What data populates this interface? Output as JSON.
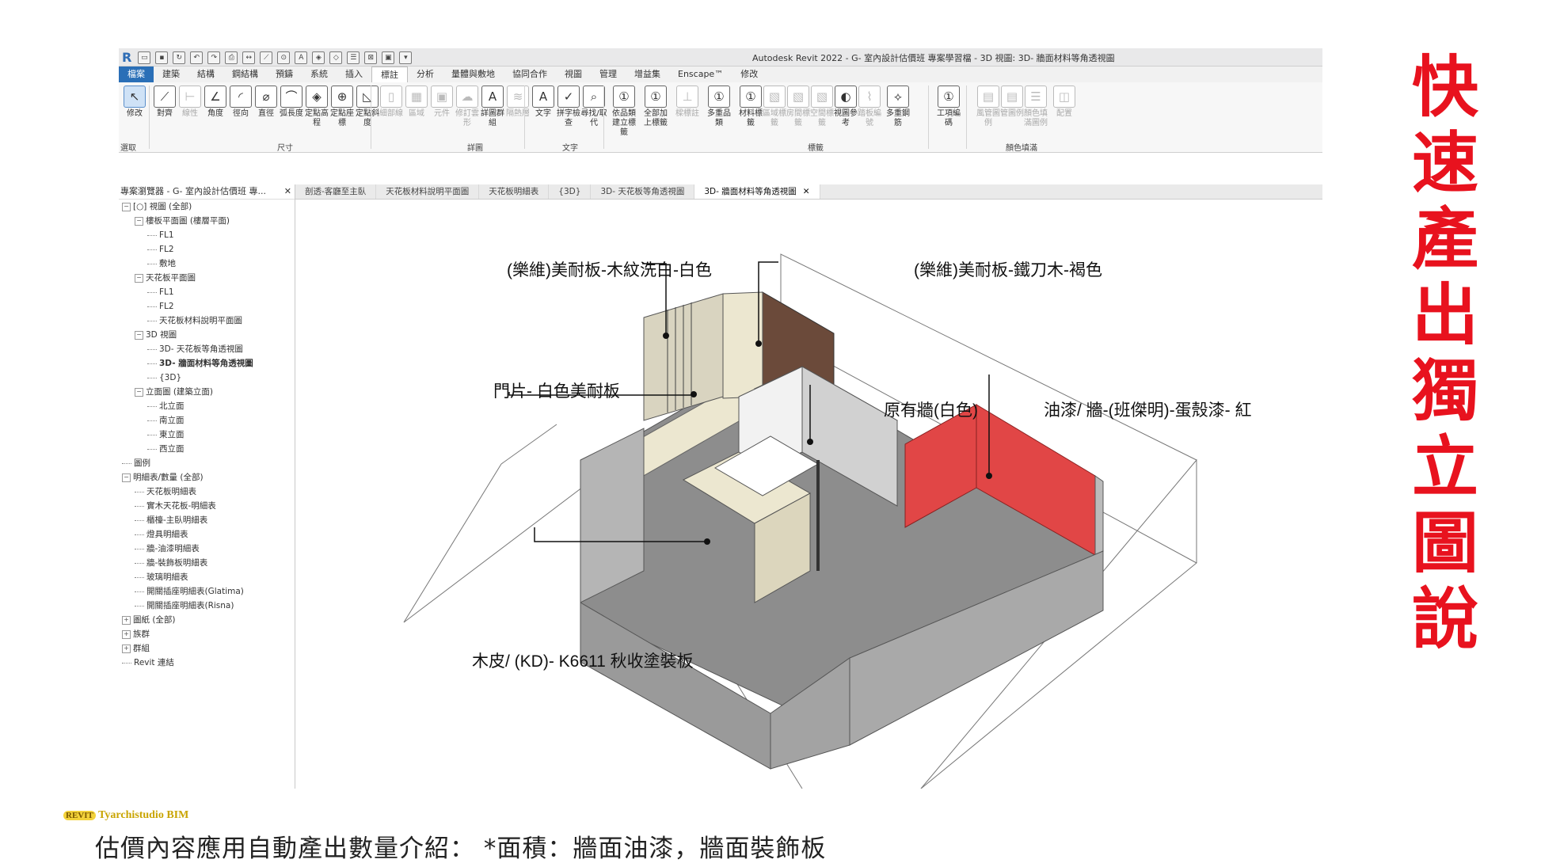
{
  "app": {
    "window_title": "Autodesk Revit 2022 - G- 室內設計估價班 專案學習檔 - 3D 視圖: 3D- 牆面材料等角透視圖",
    "logo_letter": "R",
    "ribbon_tabs": [
      "檔案",
      "建築",
      "結構",
      "鋼結構",
      "預鑄",
      "系統",
      "插入",
      "標註",
      "分析",
      "量體與敷地",
      "協同合作",
      "視圖",
      "管理",
      "增益集",
      "Enscape™",
      "修改"
    ],
    "active_tab_index": 7,
    "ribbon_buttons": [
      {
        "label": "修改",
        "icon": "cursor-icon",
        "glyph": "↖",
        "state": "sel"
      },
      {
        "label": "對齊",
        "icon": "aligned-dim-icon",
        "glyph": "⟋",
        "state": ""
      },
      {
        "label": "線性",
        "icon": "linear-dim-icon",
        "glyph": "⊢",
        "state": "dim"
      },
      {
        "label": "角度",
        "icon": "angular-dim-icon",
        "glyph": "∠",
        "state": ""
      },
      {
        "label": "徑向",
        "icon": "radial-dim-icon",
        "glyph": "◜",
        "state": ""
      },
      {
        "label": "直徑",
        "icon": "diameter-dim-icon",
        "glyph": "⌀",
        "state": ""
      },
      {
        "label": "弧長度",
        "icon": "arc-length-icon",
        "glyph": "⌒",
        "state": ""
      },
      {
        "label": "定點高程",
        "icon": "spot-elevation-icon",
        "glyph": "◈",
        "state": ""
      },
      {
        "label": "定點座標",
        "icon": "spot-coordinate-icon",
        "glyph": "⊕",
        "state": ""
      },
      {
        "label": "定點斜度",
        "icon": "spot-slope-icon",
        "glyph": "◺",
        "state": ""
      },
      {
        "label": "細部線",
        "icon": "detail-line-icon",
        "glyph": "▯",
        "state": "dim"
      },
      {
        "label": "區域",
        "icon": "region-icon",
        "glyph": "▦",
        "state": "dim"
      },
      {
        "label": "元件",
        "icon": "component-icon",
        "glyph": "▣",
        "state": "dim"
      },
      {
        "label": "修訂雲形",
        "icon": "revision-cloud-icon",
        "glyph": "☁",
        "state": "dim"
      },
      {
        "label": "詳圖群組",
        "icon": "detail-group-icon",
        "glyph": "A",
        "state": ""
      },
      {
        "label": "隔熱層",
        "icon": "insulation-icon",
        "glyph": "≋",
        "state": "dim"
      },
      {
        "label": "文字",
        "icon": "text-icon",
        "glyph": "A",
        "state": ""
      },
      {
        "label": "拼字檢查",
        "icon": "spell-check-icon",
        "glyph": "✓",
        "state": ""
      },
      {
        "label": "尋找/取代",
        "icon": "find-replace-icon",
        "glyph": "⌕",
        "state": ""
      },
      {
        "label": "依品類建立標籤",
        "icon": "tag-by-category-icon",
        "glyph": "①",
        "state": ""
      },
      {
        "label": "全部加上標籤",
        "icon": "tag-all-icon",
        "glyph": "①",
        "state": ""
      },
      {
        "label": "樑標註",
        "icon": "beam-annotation-icon",
        "glyph": "⊥",
        "state": "dim"
      },
      {
        "label": "多重品類",
        "icon": "multi-category-icon",
        "glyph": "①",
        "state": ""
      },
      {
        "label": "材料標籤",
        "icon": "material-tag-icon",
        "glyph": "①",
        "state": ""
      },
      {
        "label": "區域標籤",
        "icon": "area-tag-icon",
        "glyph": "▧",
        "state": "dim"
      },
      {
        "label": "房間標籤",
        "icon": "room-tag-icon",
        "glyph": "▧",
        "state": "dim"
      },
      {
        "label": "空間標籤",
        "icon": "space-tag-icon",
        "glyph": "▧",
        "state": "dim"
      },
      {
        "label": "視圖參考",
        "icon": "view-reference-icon",
        "glyph": "◐",
        "state": ""
      },
      {
        "label": "踏板編號",
        "icon": "tread-number-icon",
        "glyph": "⌇",
        "state": "dim"
      },
      {
        "label": "多重鋼筋",
        "icon": "multi-rebar-icon",
        "glyph": "⟡",
        "state": ""
      },
      {
        "label": "工項編碼",
        "icon": "keynote-icon",
        "glyph": "①",
        "state": ""
      },
      {
        "label": "風管圖例",
        "icon": "duct-legend-icon",
        "glyph": "▤",
        "state": "dim"
      },
      {
        "label": "管圖例",
        "icon": "pipe-legend-icon",
        "glyph": "▤",
        "state": "dim"
      },
      {
        "label": "顏色填滿圖例",
        "icon": "color-fill-legend-icon",
        "glyph": "☰",
        "state": "dim"
      },
      {
        "label": "配置",
        "icon": "color-scheme-icon",
        "glyph": "◫",
        "state": "dim"
      }
    ],
    "panel_labels": [
      "選取",
      "尺寸",
      "詳圖",
      "文字",
      "標籤",
      "顏色填滿"
    ],
    "browser_title": "專案瀏覽器 - G- 室內設計估價班 專...",
    "tree": [
      {
        "level": 0,
        "toggle": "⊟",
        "text": "[○] 視圖 (全部)"
      },
      {
        "level": 1,
        "toggle": "⊟",
        "text": "樓板平面圖 (樓層平面)"
      },
      {
        "level": 2,
        "toggle": "",
        "text": "FL1"
      },
      {
        "level": 2,
        "toggle": "",
        "text": "FL2"
      },
      {
        "level": 2,
        "toggle": "",
        "text": "敷地"
      },
      {
        "level": 1,
        "toggle": "⊟",
        "text": "天花板平面圖"
      },
      {
        "level": 2,
        "toggle": "",
        "text": "FL1"
      },
      {
        "level": 2,
        "toggle": "",
        "text": "FL2"
      },
      {
        "level": 2,
        "toggle": "",
        "text": "天花板材料說明平面圖"
      },
      {
        "level": 1,
        "toggle": "⊟",
        "text": "3D 視圖"
      },
      {
        "level": 2,
        "toggle": "",
        "text": "3D- 天花板等角透視圖"
      },
      {
        "level": 2,
        "toggle": "",
        "text": "3D- 牆面材料等角透視圖",
        "bold": true
      },
      {
        "level": 2,
        "toggle": "",
        "text": "{3D}"
      },
      {
        "level": 1,
        "toggle": "⊟",
        "text": "立面圖 (建築立面)"
      },
      {
        "level": 2,
        "toggle": "",
        "text": "北立面"
      },
      {
        "level": 2,
        "toggle": "",
        "text": "南立面"
      },
      {
        "level": 2,
        "toggle": "",
        "text": "東立面"
      },
      {
        "level": 2,
        "toggle": "",
        "text": "西立面"
      },
      {
        "level": 0,
        "toggle": "",
        "text": "圖例"
      },
      {
        "level": 0,
        "toggle": "⊟",
        "text": "明細表/數量 (全部)"
      },
      {
        "level": 1,
        "toggle": "",
        "text": "天花板明細表"
      },
      {
        "level": 1,
        "toggle": "",
        "text": "實木天花板-明細表"
      },
      {
        "level": 1,
        "toggle": "",
        "text": "櫃檯-主臥明細表"
      },
      {
        "level": 1,
        "toggle": "",
        "text": "燈具明細表"
      },
      {
        "level": 1,
        "toggle": "",
        "text": "牆-油漆明細表"
      },
      {
        "level": 1,
        "toggle": "",
        "text": "牆-裝飾板明細表"
      },
      {
        "level": 1,
        "toggle": "",
        "text": "玻璃明細表"
      },
      {
        "level": 1,
        "toggle": "",
        "text": "開關插座明細表(Glatima)"
      },
      {
        "level": 1,
        "toggle": "",
        "text": "開關插座明細表(Risna)"
      },
      {
        "level": 0,
        "toggle": "⊞",
        "text": "圖紙 (全部)"
      },
      {
        "level": 0,
        "toggle": "⊞",
        "text": "族群"
      },
      {
        "level": 0,
        "toggle": "⊞",
        "text": "群組"
      },
      {
        "level": 0,
        "toggle": "",
        "text": "Revit 連結"
      }
    ],
    "doc_tabs": [
      {
        "label": "剖透-客廳至主臥",
        "active": false
      },
      {
        "label": "天花板材料說明平面圖",
        "active": false
      },
      {
        "label": "天花板明細表",
        "active": false
      },
      {
        "label": "{3D}",
        "active": false
      },
      {
        "label": "3D- 天花板等角透視圖",
        "active": false
      },
      {
        "label": "3D- 牆面材料等角透視圖",
        "active": true
      }
    ]
  },
  "annotations": {
    "a1": "(樂維)美耐板-木紋洗白-白色",
    "a2": "(樂維)美耐板-鐵刀木-褐色",
    "a3": "門片-  白色美耐板",
    "a4": "原有牆(白色)",
    "a5": "油漆/ 牆-(班傑明)-蛋殼漆- 紅",
    "a6": "木皮/ (KD)- K6611 秋收塗裝板"
  },
  "colors": {
    "accent_red": "#e8121e",
    "revit_blue": "#2a6fb7",
    "wall_gray": "#a9a9a9",
    "floor_gray": "#8e8e8e",
    "red_paint": "#e14646",
    "wood_brown": "#6b4a3a",
    "cream": "#ece7d0"
  },
  "side_title_chars": [
    "快",
    "速",
    "產",
    "出",
    "獨",
    "立",
    "圖",
    "說"
  ],
  "footer": {
    "logo_badge": "REVIT",
    "logo_text": "Tyarchistudio BIM",
    "caption": "估價內容應用自動產出數量介紹： *面積：牆面油漆，牆面裝飾板"
  }
}
